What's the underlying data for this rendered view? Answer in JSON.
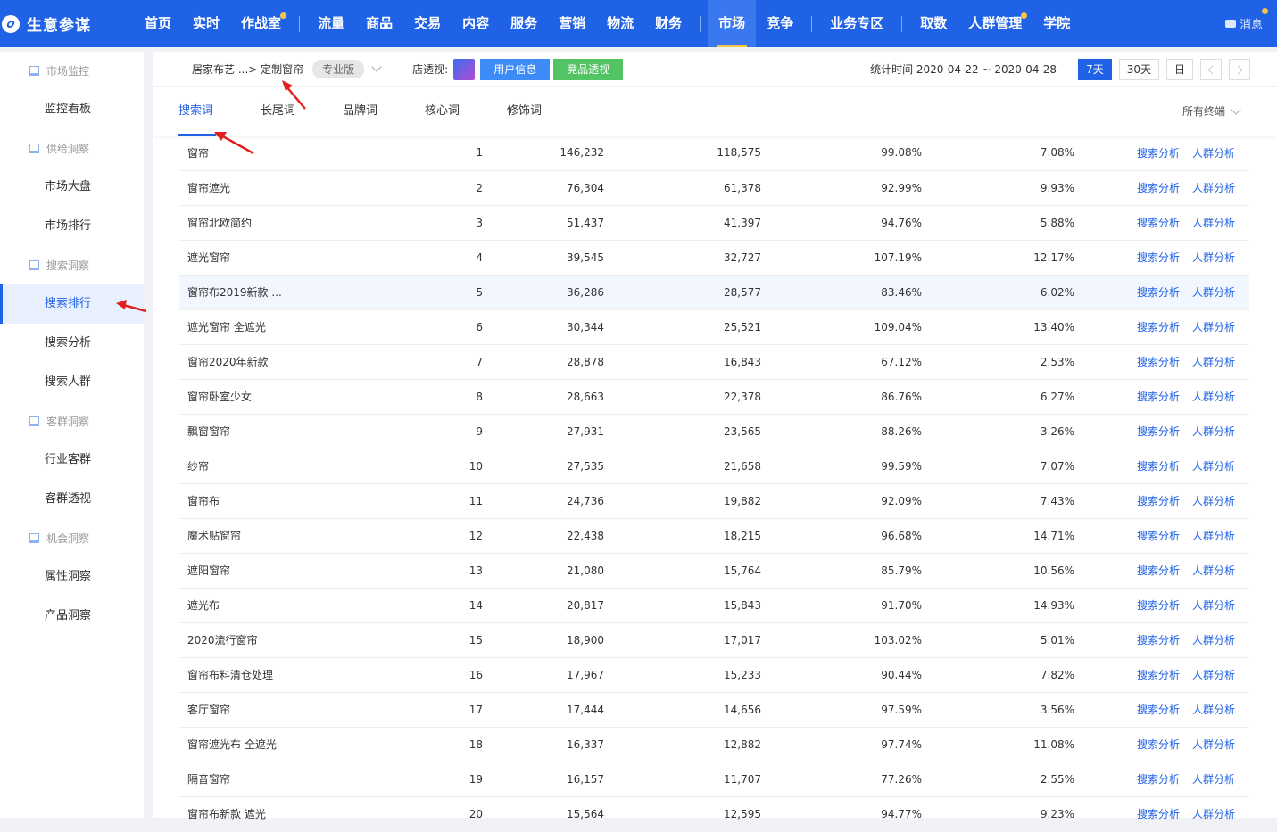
{
  "app": {
    "title": "生意参谋"
  },
  "topnav": {
    "items": [
      {
        "label": "首页",
        "dot": false
      },
      {
        "label": "实时",
        "dot": false
      },
      {
        "label": "作战室",
        "dot": true
      },
      {
        "sep": true
      },
      {
        "label": "流量",
        "dot": false
      },
      {
        "label": "商品",
        "dot": false
      },
      {
        "label": "交易",
        "dot": false
      },
      {
        "label": "内容",
        "dot": false
      },
      {
        "label": "服务",
        "dot": false
      },
      {
        "label": "营销",
        "dot": false
      },
      {
        "label": "物流",
        "dot": false
      },
      {
        "label": "财务",
        "dot": false
      },
      {
        "sep": true
      },
      {
        "label": "市场",
        "dot": false,
        "active": true
      },
      {
        "label": "竞争",
        "dot": false
      },
      {
        "sep": true
      },
      {
        "label": "业务专区",
        "dot": false
      },
      {
        "sep": true
      },
      {
        "label": "取数",
        "dot": false
      },
      {
        "label": "人群管理",
        "dot": true
      },
      {
        "label": "学院",
        "dot": false
      }
    ],
    "message_label": "消息"
  },
  "sidebar": [
    {
      "type": "group",
      "label": "市场监控"
    },
    {
      "type": "item",
      "label": "监控看板"
    },
    {
      "type": "group",
      "label": "供给洞察"
    },
    {
      "type": "item",
      "label": "市场大盘"
    },
    {
      "type": "item",
      "label": "市场排行"
    },
    {
      "type": "group",
      "label": "搜索洞察"
    },
    {
      "type": "item",
      "label": "搜索排行",
      "active": true
    },
    {
      "type": "item",
      "label": "搜索分析"
    },
    {
      "type": "item",
      "label": "搜索人群"
    },
    {
      "type": "group",
      "label": "客群洞察"
    },
    {
      "type": "item",
      "label": "行业客群"
    },
    {
      "type": "item",
      "label": "客群透视"
    },
    {
      "type": "group",
      "label": "机会洞察"
    },
    {
      "type": "item",
      "label": "属性洞察"
    },
    {
      "type": "item",
      "label": "产品洞察"
    }
  ],
  "subbar": {
    "breadcrumb": "居家布艺 ...> 定制窗帘",
    "edition_badge": "专业版",
    "shop_view_label": "店透视:",
    "user_info_button": "用户信息",
    "competitor_button": "竞品透视",
    "stat_time": "统计时间 2020-04-22 ~ 2020-04-28",
    "ranges": [
      {
        "label": "7天",
        "active": true
      },
      {
        "label": "30天",
        "active": false
      },
      {
        "label": "日",
        "active": false
      }
    ]
  },
  "tabs": [
    {
      "label": "搜索词",
      "active": true
    },
    {
      "label": "长尾词",
      "active": false
    },
    {
      "label": "品牌词",
      "active": false
    },
    {
      "label": "核心词",
      "active": false
    },
    {
      "label": "修饰词",
      "active": false
    }
  ],
  "terminal_filter": "所有终端",
  "table": {
    "action_search": "搜索分析",
    "action_crowd": "人群分析",
    "rows": [
      {
        "keyword": "窗帘",
        "rank": "1",
        "c1": "146,232",
        "c2": "118,575",
        "c3": "99.08%",
        "c4": "7.08%"
      },
      {
        "keyword": "窗帘遮光",
        "rank": "2",
        "c1": "76,304",
        "c2": "61,378",
        "c3": "92.99%",
        "c4": "9.93%"
      },
      {
        "keyword": "窗帘北欧简约",
        "rank": "3",
        "c1": "51,437",
        "c2": "41,397",
        "c3": "94.76%",
        "c4": "5.88%"
      },
      {
        "keyword": "遮光窗帘",
        "rank": "4",
        "c1": "39,545",
        "c2": "32,727",
        "c3": "107.19%",
        "c4": "12.17%"
      },
      {
        "keyword": "窗帘布2019新款 ...",
        "rank": "5",
        "c1": "36,286",
        "c2": "28,577",
        "c3": "83.46%",
        "c4": "6.02%",
        "highlight": true
      },
      {
        "keyword": "遮光窗帘 全遮光",
        "rank": "6",
        "c1": "30,344",
        "c2": "25,521",
        "c3": "109.04%",
        "c4": "13.40%"
      },
      {
        "keyword": "窗帘2020年新款",
        "rank": "7",
        "c1": "28,878",
        "c2": "16,843",
        "c3": "67.12%",
        "c4": "2.53%"
      },
      {
        "keyword": "窗帘卧室少女",
        "rank": "8",
        "c1": "28,663",
        "c2": "22,378",
        "c3": "86.76%",
        "c4": "6.27%"
      },
      {
        "keyword": "飘窗窗帘",
        "rank": "9",
        "c1": "27,931",
        "c2": "23,565",
        "c3": "88.26%",
        "c4": "3.26%"
      },
      {
        "keyword": "纱帘",
        "rank": "10",
        "c1": "27,535",
        "c2": "21,658",
        "c3": "99.59%",
        "c4": "7.07%"
      },
      {
        "keyword": "窗帘布",
        "rank": "11",
        "c1": "24,736",
        "c2": "19,882",
        "c3": "92.09%",
        "c4": "7.43%"
      },
      {
        "keyword": "魔术贴窗帘",
        "rank": "12",
        "c1": "22,438",
        "c2": "18,215",
        "c3": "96.68%",
        "c4": "14.71%"
      },
      {
        "keyword": "遮阳窗帘",
        "rank": "13",
        "c1": "21,080",
        "c2": "15,764",
        "c3": "85.79%",
        "c4": "10.56%"
      },
      {
        "keyword": "遮光布",
        "rank": "14",
        "c1": "20,817",
        "c2": "15,843",
        "c3": "91.70%",
        "c4": "14.93%"
      },
      {
        "keyword": "2020流行窗帘",
        "rank": "15",
        "c1": "18,900",
        "c2": "17,017",
        "c3": "103.02%",
        "c4": "5.01%"
      },
      {
        "keyword": "窗帘布料清仓处理",
        "rank": "16",
        "c1": "17,967",
        "c2": "15,233",
        "c3": "90.44%",
        "c4": "7.82%"
      },
      {
        "keyword": "客厅窗帘",
        "rank": "17",
        "c1": "17,444",
        "c2": "14,656",
        "c3": "97.59%",
        "c4": "3.56%"
      },
      {
        "keyword": "窗帘遮光布 全遮光",
        "rank": "18",
        "c1": "16,337",
        "c2": "12,882",
        "c3": "97.74%",
        "c4": "11.08%"
      },
      {
        "keyword": "隔音窗帘",
        "rank": "19",
        "c1": "16,157",
        "c2": "11,707",
        "c3": "77.26%",
        "c4": "2.55%"
      },
      {
        "keyword": "窗帘布新款 遮光",
        "rank": "20",
        "c1": "15,564",
        "c2": "12,595",
        "c3": "94.77%",
        "c4": "9.23%"
      }
    ]
  },
  "colors": {
    "nav_blue": "#2062e6",
    "accent_yellow": "#f5c542",
    "link_blue": "#2062e6",
    "arrow_red": "#e02020"
  }
}
